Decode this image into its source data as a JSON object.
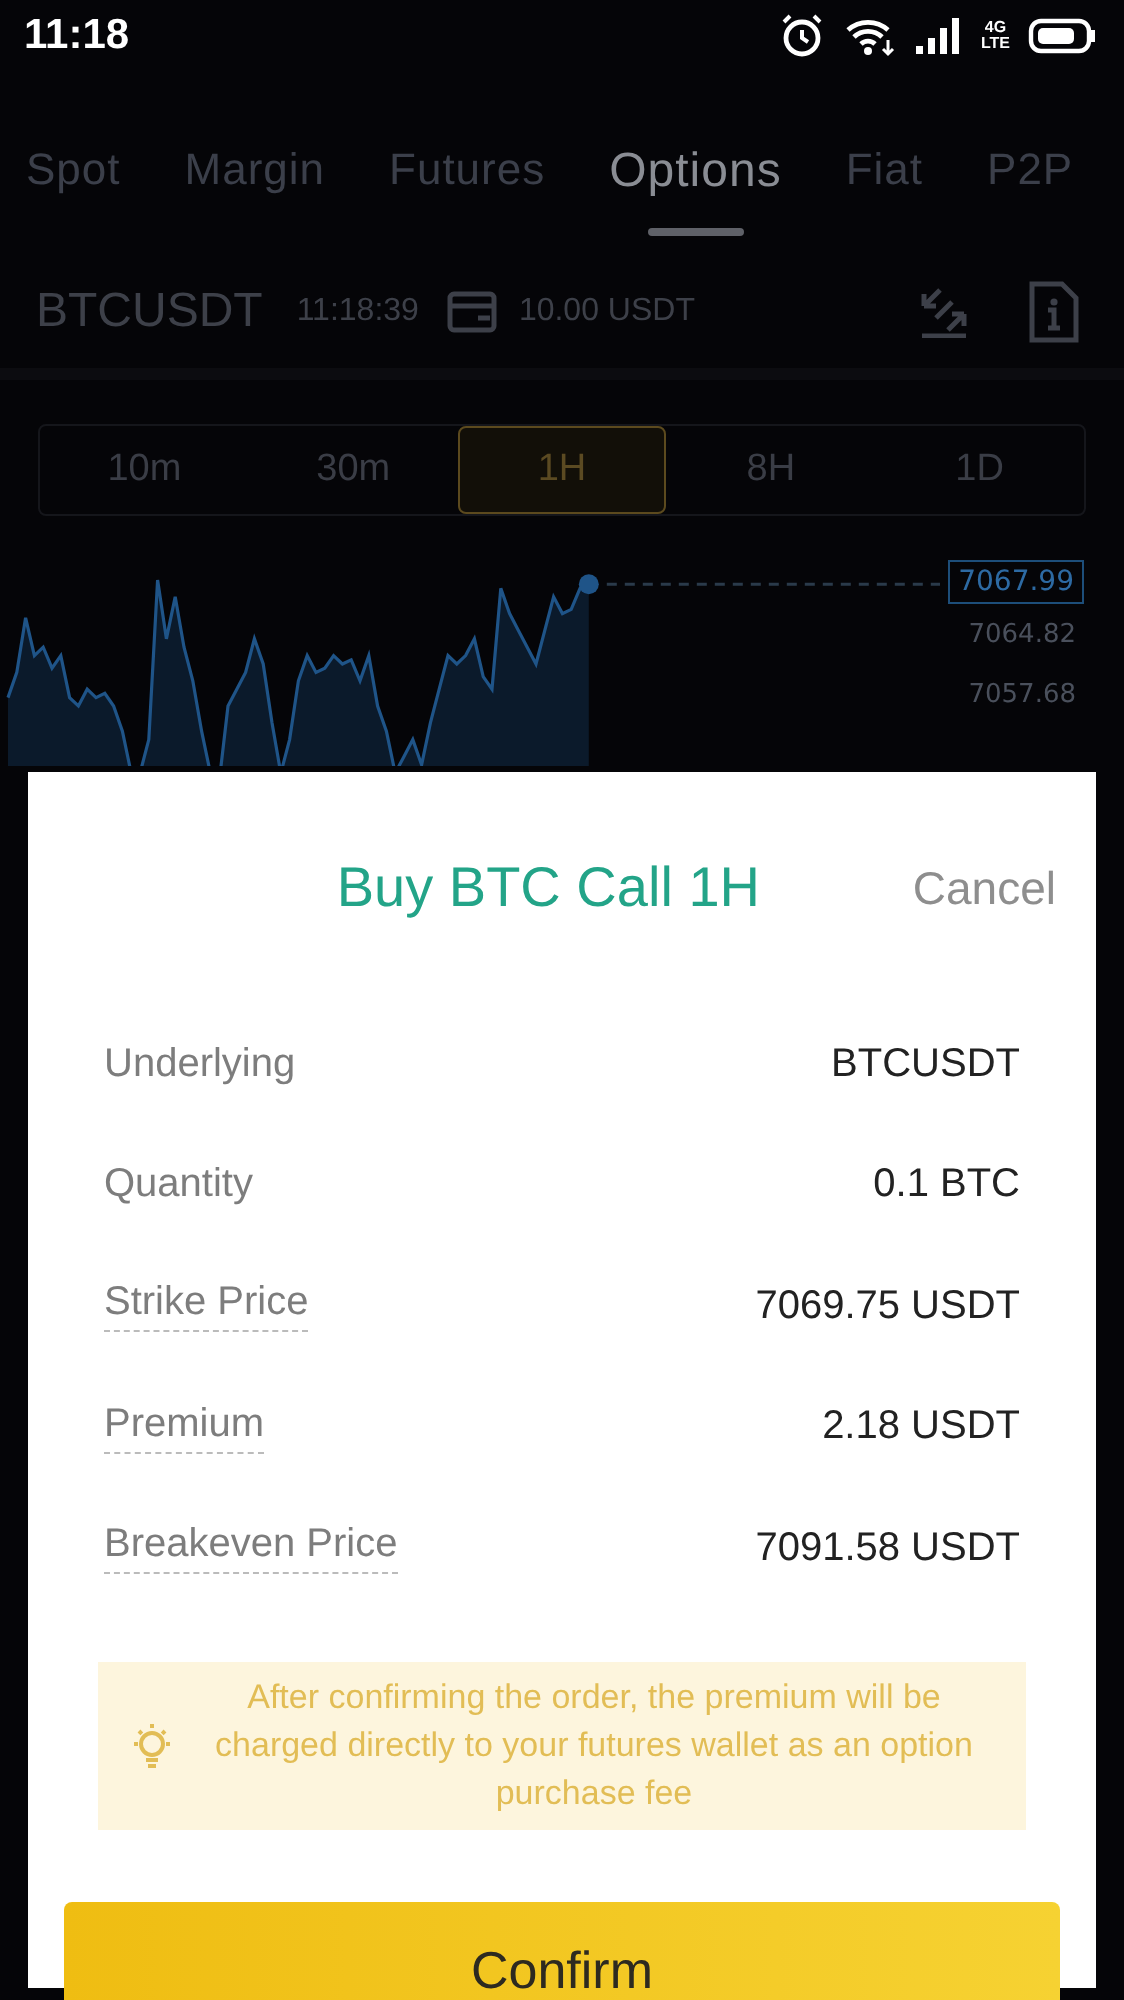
{
  "status_bar": {
    "time": "11:18",
    "network": [
      "4G",
      "LTE"
    ]
  },
  "tabs": [
    {
      "label": "Spot",
      "selected": false
    },
    {
      "label": "Margin",
      "selected": false
    },
    {
      "label": "Futures",
      "selected": false
    },
    {
      "label": "Options",
      "selected": true
    },
    {
      "label": "Fiat",
      "selected": false
    },
    {
      "label": "P2P",
      "selected": false
    }
  ],
  "ticker": {
    "symbol": "BTCUSDT",
    "time": "11:18:39",
    "balance": "10.00 USDT"
  },
  "intervals": [
    {
      "label": "10m",
      "selected": false
    },
    {
      "label": "30m",
      "selected": false
    },
    {
      "label": "1H",
      "selected": true
    },
    {
      "label": "8H",
      "selected": false
    },
    {
      "label": "1D",
      "selected": false
    }
  ],
  "chart": {
    "current_price": "7067.99",
    "axis_labels": [
      "7064.82",
      "7057.68"
    ]
  },
  "order_dialog": {
    "title": "Buy BTC Call 1H",
    "cancel": "Cancel",
    "rows": [
      {
        "label": "Underlying",
        "value": "BTCUSDT",
        "underlined": false
      },
      {
        "label": "Quantity",
        "value": "0.1 BTC",
        "underlined": false
      },
      {
        "label": "Strike Price",
        "value": "7069.75 USDT",
        "underlined": true
      },
      {
        "label": "Premium",
        "value": "2.18 USDT",
        "underlined": true
      },
      {
        "label": "Breakeven Price",
        "value": "7091.58 USDT",
        "underlined": true
      }
    ],
    "notice": "After confirming the order, the premium will be charged directly to your futures wallet as an option purchase fee",
    "confirm": "Confirm"
  }
}
